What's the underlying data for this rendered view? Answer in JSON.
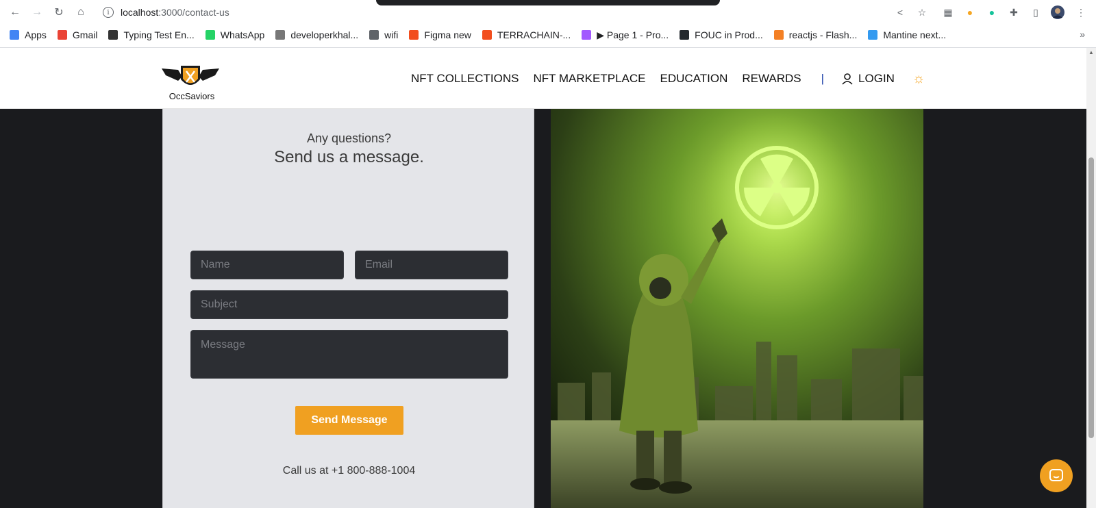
{
  "browser": {
    "url_host": "localhost",
    "url_path": ":3000/contact-us",
    "bookmarks": [
      {
        "label": "Apps",
        "color": "#4285f4"
      },
      {
        "label": "Gmail",
        "color": "#ea4335"
      },
      {
        "label": "Typing Test En...",
        "color": "#333333"
      },
      {
        "label": "WhatsApp",
        "color": "#25d366"
      },
      {
        "label": "developerkhal...",
        "color": "#777777"
      },
      {
        "label": "wifi",
        "color": "#5f6368"
      },
      {
        "label": "Figma new",
        "color": "#f24e1e"
      },
      {
        "label": "TERRACHAIN-...",
        "color": "#f24e1e"
      },
      {
        "label": "▶ Page 1 - Pro...",
        "color": "#a259ff"
      },
      {
        "label": "FOUC in Prod...",
        "color": "#24292e"
      },
      {
        "label": "reactjs - Flash...",
        "color": "#f48024"
      },
      {
        "label": "Mantine next...",
        "color": "#339af0"
      }
    ],
    "bookmarks_more": "»"
  },
  "header": {
    "logo_text": "OccSaviors",
    "nav": [
      "NFT COLLECTIONS",
      "NFT MARKETPLACE",
      "EDUCATION",
      "REWARDS"
    ],
    "separator": "|",
    "login_label": "LOGIN",
    "theme_icon": "sun-icon"
  },
  "contact": {
    "eyebrow": "Any questions?",
    "heading": "Send us a message.",
    "name_placeholder": "Name",
    "email_placeholder": "Email",
    "subject_placeholder": "Subject",
    "message_placeholder": "Message",
    "send_label": "Send Message",
    "call_text": "Call us at +1 800-888-1004"
  },
  "colors": {
    "accent": "#f0a021",
    "page_bg": "#1a1b1e",
    "panel_bg": "#e4e5e9",
    "input_bg": "#2c2e33"
  }
}
